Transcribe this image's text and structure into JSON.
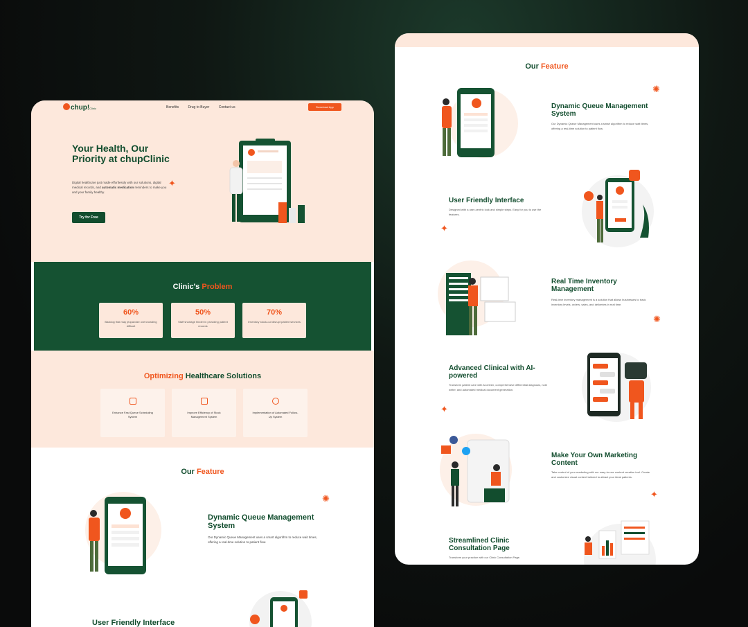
{
  "left_page": {
    "nav": {
      "logo": "chup!",
      "logo_sub": "Clinic",
      "links": [
        "Benefits",
        "Drug to Buyer",
        "Contact us"
      ],
      "cta": "Download App"
    },
    "hero": {
      "title": "Your Health, Our Priority at chupClinic",
      "description_pre": "Digital healthcare just made effortlessly with our solutions, digital medical records, and ",
      "description_bold": "automatic medication",
      "description_post": " reminders to make you and your family healthy.",
      "button": "Try for Free"
    },
    "problems": {
      "title_a": "Clinic's",
      "title_b": "Problem",
      "cards": [
        {
          "value": "60%",
          "text": "Backlog that may jeopardize overcrowding difficult"
        },
        {
          "value": "50%",
          "text": "Staff shortage hinder in providing patient records"
        },
        {
          "value": "70%",
          "text": "Inventory stock-out disrupt patient services"
        }
      ]
    },
    "optimizing": {
      "title_a": "Optimizing",
      "title_b": "Healthcare Solutions",
      "cards": [
        {
          "text": "Enhance Fast Queue Scheduling System"
        },
        {
          "text": "Improve Efficiency of Stock Management System"
        },
        {
          "text": "Implementation of Automated Follow-Up System"
        }
      ]
    },
    "features": {
      "title_a": "Our",
      "title_b": "Feature",
      "f1_title": "Dynamic Queue Management System",
      "f1_desc": "Our Dynamic Queue Management uses a smart algorithm to reduce wait times, offering a real-time solution to patient flow.",
      "f2_title": "User Friendly Interface"
    }
  },
  "right_page": {
    "title_a": "Our",
    "title_b": "Feature",
    "features": [
      {
        "title": "Dynamic Queue Management System",
        "desc": "Our Dynamic Queue Management uses a smart algorithm to reduce wait times, offering a real-time solution to patient flow."
      },
      {
        "title": "User Friendly Interface",
        "desc": "Designed with a user-centric look and simple steps. Easy for you to use the features."
      },
      {
        "title": "Real Time Inventory Management",
        "desc": "Real-time inventory management is a solution that allows businesses to track inventory levels, orders, sales, and deliveries in real time."
      },
      {
        "title": "Advanced Clinical with AI-powered",
        "desc": "Transform patient care with AI-driven, comprehensive differential diagnosis, note writer, and automated medical document generation."
      },
      {
        "title": "Make Your Own Marketing Content",
        "desc": "Take control of your marketing with our easy-to-use content creation tool. Create and customize visual content tailored to attract your ideal patients."
      },
      {
        "title": "Streamlined Clinic Consultation Page",
        "desc": "Transform your practice with our Clinic Consultation Page."
      }
    ]
  },
  "colors": {
    "brand_green": "#124d2e",
    "accent_orange": "#f0561e",
    "peach": "#fde8dc"
  }
}
